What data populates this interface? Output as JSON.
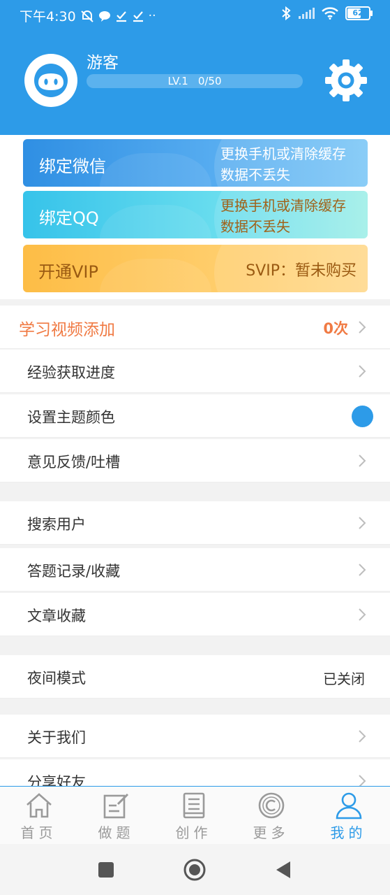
{
  "status": {
    "time": "下午4:30",
    "battery": "62"
  },
  "profile": {
    "name": "游客",
    "level": "LV.1",
    "exp": "0/50"
  },
  "cards": {
    "wechat": {
      "title": "绑定微信",
      "sub1": "更换手机或清除缓存",
      "sub2": "数据不丢失"
    },
    "qq": {
      "title": "绑定QQ",
      "sub1": "更换手机或清除缓存",
      "sub2": "数据不丢失"
    },
    "vip": {
      "title": "开通VIP",
      "status": "SVIP：暂未购买"
    }
  },
  "menu": {
    "video_add": {
      "label": "学习视频添加",
      "value": "0次"
    },
    "exp_progress": "经验获取进度",
    "theme_color": {
      "label": "设置主题颜色",
      "color": "#2d9be8"
    },
    "feedback": "意见反馈/吐槽",
    "search_user": "搜索用户",
    "answer_records": "答题记录/收藏",
    "article_fav": "文章收藏",
    "night_mode": {
      "label": "夜间模式",
      "value": "已关闭"
    },
    "about": "关于我们",
    "share": "分享好友"
  },
  "tabs": [
    {
      "label": "首页",
      "icon": "home-icon"
    },
    {
      "label": "做题",
      "icon": "edit-icon"
    },
    {
      "label": "创作",
      "icon": "book-icon"
    },
    {
      "label": "更多",
      "icon": "copyright-icon"
    },
    {
      "label": "我的",
      "icon": "person-icon",
      "active": true
    }
  ],
  "colors": {
    "primary": "#2d9be8",
    "highlight": "#f07a43"
  }
}
